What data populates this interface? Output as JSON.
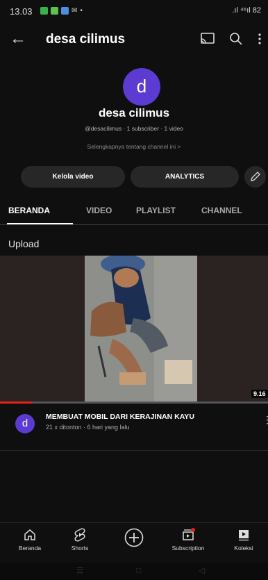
{
  "status_bar": {
    "time": "13.03",
    "signal": ".ıl ⁴⁶ıl 82"
  },
  "header": {
    "back_icon": "arrow-left-icon",
    "title": "desa cilimus"
  },
  "channel": {
    "avatar_letter": "d",
    "name": "desa cilimus",
    "meta": "@desacilimus · 1 subscriber · 1 video",
    "more": "Selengkapnya tentang channel ini  >"
  },
  "actions": {
    "manage": "Kelola video",
    "analytics": "ANALYTICS"
  },
  "tabs": [
    "BERANDA",
    "VIDEO",
    "PLAYLIST",
    "CHANNEL"
  ],
  "section_title": "Upload",
  "video": {
    "duration": "9.16",
    "avatar_letter": "d",
    "title": "MEMBUAT MOBIL DARI KERAJINAN KAYU",
    "meta": "21 x ditonton · 6 hari yang lalu",
    "progress": 0.12
  },
  "bottom_nav": [
    "Beranda",
    "Shorts",
    "Subscription",
    "Koleksi"
  ],
  "colors": {
    "accent": "#5b3bd2",
    "progress": "#e62117",
    "background": "#0f0f0f"
  }
}
